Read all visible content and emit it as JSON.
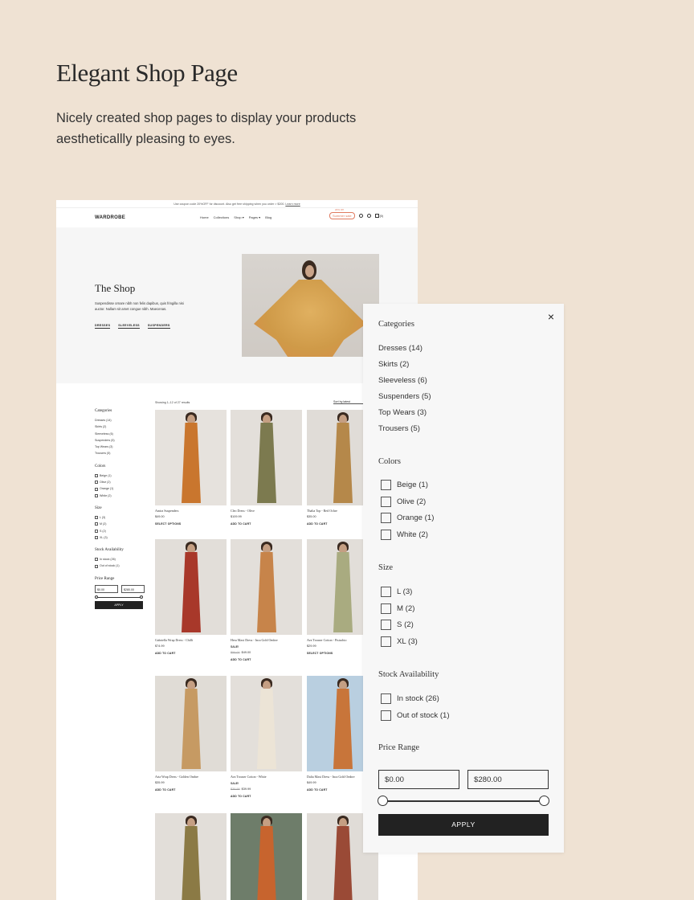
{
  "intro": {
    "headline": "Elegant Shop Page",
    "subtext": "Nicely created shop pages to display your products aestheticallly pleasing to eyes."
  },
  "store": {
    "announcement": "Use coupon code 20%OFF for discount. Also get free shipping when you order > $200.",
    "announcement_link": "Learn more",
    "logo": "WARDROBE",
    "nav": [
      "Home",
      "Collections",
      "Shop ▾",
      "Pages ▾",
      "Blog"
    ],
    "sale_top": "20% Off",
    "sale_label": "Summer sale",
    "cart_count": "(0)"
  },
  "hero": {
    "title": "The Shop",
    "description": "Suspendisse ornare nibh non felis dapibus, quis fringilla nisi auctor. Nullam sit amet congue nibh. Maecenas.",
    "links": [
      "DRESSES",
      "SLEEVELESS",
      "SUSPENDERS"
    ]
  },
  "listing": {
    "results": "Showing 1–12 of 27 results",
    "sort": "Sort by latest"
  },
  "mini_filters": {
    "categories_title": "Categories",
    "categories": [
      "Dresses (14)",
      "Skirts (2)",
      "Sleeveless (6)",
      "Suspenders (5)",
      "Top Wears (3)",
      "Trousers (5)"
    ],
    "colors_title": "Colors",
    "colors": [
      "Beige (1)",
      "Olive (2)",
      "Orange (1)",
      "White (2)"
    ],
    "size_title": "Size",
    "sizes": [
      "L (3)",
      "M (2)",
      "S (2)",
      "XL (3)"
    ],
    "stock_title": "Stock Availability",
    "stock": [
      "In stock (26)",
      "Out of stock (1)"
    ],
    "price_title": "Price Range",
    "price_min": "$0.00",
    "price_max": "$280.00",
    "apply": "APPLY"
  },
  "products": [
    {
      "name": "Amira Suspenders",
      "tag": "",
      "old_price": "",
      "price": "$49.00",
      "action": "SELECT OPTIONS",
      "bg": "#e6e2dd",
      "fig": "#c9762e"
    },
    {
      "name": "Cleo Dress - Olive",
      "tag": "",
      "old_price": "",
      "price": "$109.99",
      "action": "ADD TO CART",
      "bg": "#e3dfda",
      "fig": "#7c7a4f"
    },
    {
      "name": "Thalia Top - Red Ochre",
      "tag": "",
      "old_price": "",
      "price": "$35.00",
      "action": "ADD TO CART",
      "bg": "#e0dcd7",
      "fig": "#b5884a"
    },
    {
      "name": "Gabriella Wrap Dress - Chilli",
      "tag": "",
      "old_price": "",
      "price": "$74.99",
      "action": "ADD TO CART",
      "bg": "#e2ded9",
      "fig": "#a8382a"
    },
    {
      "name": "Hera Maxi Dress - Inca Gold Ombre",
      "tag": "SALE!",
      "old_price": "$59.00",
      "price": "$49.00",
      "action": "ADD TO CART",
      "bg": "#e3dfda",
      "fig": "#c7844a"
    },
    {
      "name": "Ava Trouser Cotton - Pistachio",
      "tag": "",
      "old_price": "",
      "price": "$29.99",
      "action": "SELECT OPTIONS",
      "bg": "#e2ded9",
      "fig": "#a9ab80"
    },
    {
      "name": "Aria Wrap Dress - Golden Ombre",
      "tag": "",
      "old_price": "",
      "price": "$35.99",
      "action": "ADD TO CART",
      "bg": "#e0dcd6",
      "fig": "#c69a63"
    },
    {
      "name": "Ava Trouser Cotton - White",
      "tag": "SALE!",
      "old_price": "$39.99",
      "price": "$39.99",
      "action": "ADD TO CART",
      "bg": "#e3dfda",
      "fig": "#ece4d6"
    },
    {
      "name": "Dalia Maxi Dress - Inca Gold Ombre",
      "tag": "",
      "old_price": "",
      "price": "$49.99",
      "action": "ADD TO CART",
      "bg": "#b9cfe0",
      "fig": "#c8753a"
    },
    {
      "name": "",
      "tag": "",
      "old_price": "",
      "price": "",
      "action": "",
      "bg": "#e2ded9",
      "fig": "#8b7a45"
    },
    {
      "name": "",
      "tag": "",
      "old_price": "",
      "price": "",
      "action": "",
      "bg": "#6e7d6a",
      "fig": "#c7642e"
    },
    {
      "name": "",
      "tag": "",
      "old_price": "",
      "price": "",
      "action": "",
      "bg": "#e0dcd7",
      "fig": "#9a4a36"
    }
  ],
  "panel": {
    "close": "×",
    "categories_title": "Categories",
    "categories": [
      "Dresses (14)",
      "Skirts (2)",
      "Sleeveless (6)",
      "Suspenders (5)",
      "Top Wears (3)",
      "Trousers (5)"
    ],
    "colors_title": "Colors",
    "colors": [
      "Beige (1)",
      "Olive (2)",
      "Orange (1)",
      "White (2)"
    ],
    "size_title": "Size",
    "sizes": [
      "L (3)",
      "M (2)",
      "S (2)",
      "XL (3)"
    ],
    "stock_title": "Stock Availability",
    "stock": [
      "In stock (26)",
      "Out of stock (1)"
    ],
    "price_title": "Price Range",
    "price_min": "$0.00",
    "price_max": "$280.00",
    "apply": "APPLY"
  }
}
